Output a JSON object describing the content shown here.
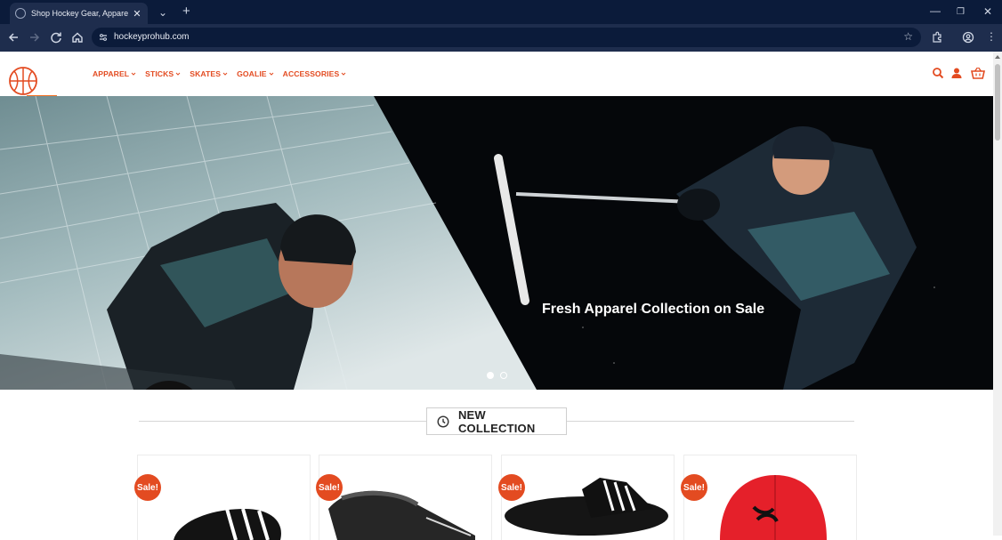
{
  "browser": {
    "tab_title": "Shop Hockey Gear, Apparel & S",
    "url": "hockeyprohub.com"
  },
  "nav": {
    "menu": [
      {
        "label": "APPAREL"
      },
      {
        "label": "STICKS"
      },
      {
        "label": "SKATES"
      },
      {
        "label": "GOALIE"
      },
      {
        "label": "ACCESSORIES"
      }
    ]
  },
  "hero": {
    "caption": "Fresh Apparel Collection on Sale",
    "slide_count": 2,
    "active_slide": 1
  },
  "section": {
    "title": "NEW COLLECTION"
  },
  "products": [
    {
      "badge": "Sale!",
      "image": "black-white-striped-slide-sandal"
    },
    {
      "badge": "Sale!",
      "image": "black-ccm-slide-sandal"
    },
    {
      "badge": "Sale!",
      "image": "black-adidas-slide-sandal"
    },
    {
      "badge": "Sale!",
      "image": "red-under-armour-cap"
    }
  ],
  "colors": {
    "accent": "#e34b21",
    "chrome_dark": "#0b1b3a",
    "chrome_bar": "#1e2d4d"
  }
}
